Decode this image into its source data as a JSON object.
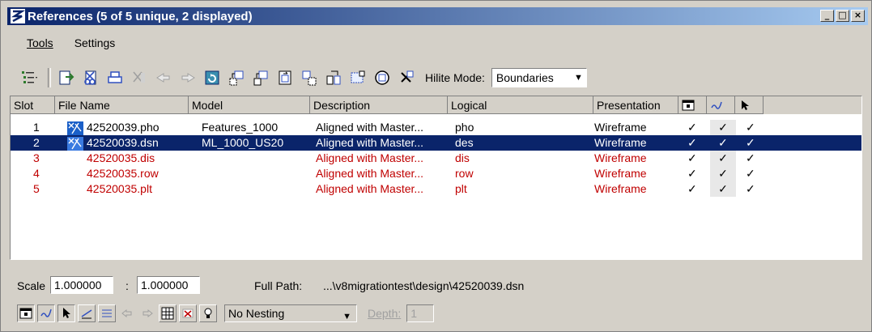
{
  "window": {
    "title": "References (5 of 5 unique, 2 displayed)",
    "controls": [
      "_",
      "□",
      "×"
    ]
  },
  "menu": {
    "items": [
      "Tools",
      "Settings"
    ]
  },
  "toolbar": {
    "hilite_label": "Hilite Mode:",
    "hilite_value": "Boundaries",
    "icons": [
      "list-tool-icon",
      "attach-icon",
      "detach-icon",
      "print-icon",
      "clip-icon",
      "move-icon",
      "copy-icon",
      "reload-icon",
      "attach-move-icon",
      "attach-copy-icon",
      "scale-icon",
      "rotate-icon",
      "mirror-icon",
      "clip-boundary-icon",
      "clip-mask-icon",
      "clip-front-icon",
      "delete-clip-icon"
    ]
  },
  "table": {
    "headers": {
      "slot": "Slot",
      "file": "File Name",
      "model": "Model",
      "description": "Description",
      "logical": "Logical",
      "presentation": "Presentation"
    },
    "rows": [
      {
        "slot": "1",
        "file": "42520039.pho",
        "model": "Features_1000",
        "description": "Aligned with Master...",
        "logical": "pho",
        "presentation": "Wireframe",
        "c1": "✓",
        "c2": "✓",
        "c3": "✓"
      },
      {
        "slot": "2",
        "file": "42520039.dsn",
        "model": "ML_1000_US20",
        "description": "Aligned with Master...",
        "logical": "des",
        "presentation": "Wireframe",
        "c1": "✓",
        "c2": "✓",
        "c3": "✓"
      },
      {
        "slot": "3",
        "file": "42520035.dis",
        "model": "",
        "description": "Aligned with Master...",
        "logical": "dis",
        "presentation": "Wireframe",
        "c1": "✓",
        "c2": "✓",
        "c3": "✓"
      },
      {
        "slot": "4",
        "file": "42520035.row",
        "model": "",
        "description": "Aligned with Master...",
        "logical": "row",
        "presentation": "Wireframe",
        "c1": "✓",
        "c2": "✓",
        "c3": "✓"
      },
      {
        "slot": "5",
        "file": "42520035.plt",
        "model": "",
        "description": "Aligned with Master...",
        "logical": "plt",
        "presentation": "Wireframe",
        "c1": "✓",
        "c2": "✓",
        "c3": "✓"
      }
    ]
  },
  "bottom": {
    "scale_label": "Scale",
    "scale_a": "1.000000",
    "scale_sep": ":",
    "scale_b": "1.000000",
    "fullpath_label": "Full Path:",
    "fullpath_value": "...\\v8migrationtest\\design\\42520039.dsn",
    "nesting_value": "No Nesting",
    "depth_label": "Depth:",
    "depth_value": "1"
  },
  "colors": {
    "selected_bg": "#0a246a",
    "unloaded_text": "#c00000"
  }
}
